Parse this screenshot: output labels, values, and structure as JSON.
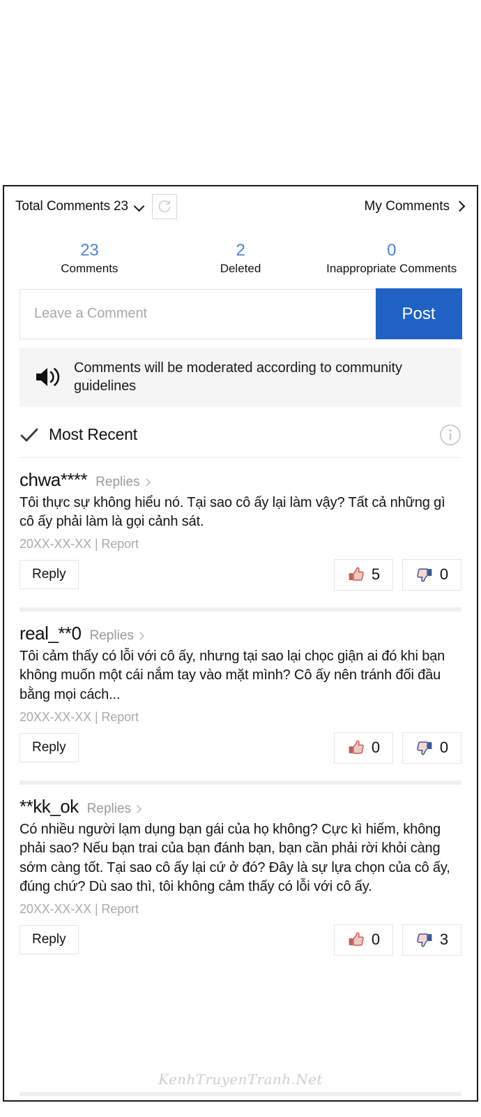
{
  "header": {
    "total_label": "Total Comments 23",
    "dropdown_icon": "chevron-down-icon",
    "refresh_icon": "refresh-icon",
    "my_comments_label": "My Comments",
    "my_comments_chevron": "chevron-right-icon"
  },
  "stats": [
    {
      "value": "23",
      "label": "Comments"
    },
    {
      "value": "2",
      "label": "Deleted"
    },
    {
      "value": "0",
      "label": "Inappropriate Comments"
    }
  ],
  "composer": {
    "placeholder": "Leave a Comment",
    "value": "",
    "post_label": "Post"
  },
  "notice": {
    "icon": "speaker-icon",
    "text": "Comments will be moderated according to community guidelines"
  },
  "sort": {
    "check_icon": "check-icon",
    "label": "Most Recent",
    "info_icon": "info-icon"
  },
  "comments": [
    {
      "user": "chwa****",
      "replies_label": "Replies",
      "body": "Tôi thực sự không hiểu nó. Tại sao cô ấy lại làm vậy? Tất cả những gì cô ấy phải làm là gọi cảnh sát.",
      "meta": "20XX-XX-XX | Report",
      "reply_label": "Reply",
      "likes": "5",
      "dislikes": "0"
    },
    {
      "user": "real_**0",
      "replies_label": "Replies",
      "body": "Tôi cảm thấy có lỗi với cô ấy, nhưng tại sao lại chọc giận ai đó khi bạn không muốn một cái nắm tay vào mặt mình? Cô ấy nên tránh đối đầu bằng mọi cách...",
      "meta": "20XX-XX-XX | Report",
      "reply_label": "Reply",
      "likes": "0",
      "dislikes": "0"
    },
    {
      "user": "**kk_ok",
      "replies_label": "Replies",
      "body": "Có nhiều người lạm dụng bạn gái của họ không? Cực kì hiếm, không phải sao? Nếu bạn trai của bạn đánh bạn, bạn cần phải rời khỏi càng sớm càng tốt. Tại sao cô ấy lại cứ ở đó? Đây là sự lựa chọn của cô ấy, đúng chứ? Dù sao thì, tôi không cảm thấy có lỗi với cô ấy.",
      "meta": "20XX-XX-XX | Report",
      "reply_label": "Reply",
      "likes": "0",
      "dislikes": "3"
    }
  ],
  "watermark": "KenhTruyenTranh.Net",
  "colors": {
    "stat_number": "#4a86d8",
    "post_button": "#1f62c4",
    "like_icon": "#c75c5c",
    "dislike_icon": "#3b5998",
    "card_border": "#1a1a1a",
    "divider": "#efefef",
    "muted_text": "#aaaaaa"
  }
}
